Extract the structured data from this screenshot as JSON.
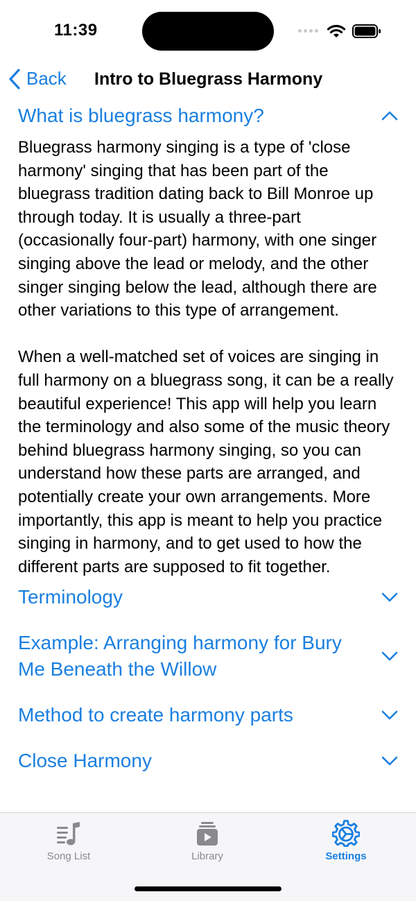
{
  "status_bar": {
    "time": "11:39"
  },
  "nav": {
    "back_label": "Back",
    "title": "Intro to Bluegrass Harmony"
  },
  "sections": [
    {
      "title": "What is bluegrass harmony?",
      "expanded": true,
      "paragraphs": [
        "Bluegrass harmony singing is a type of 'close harmony' singing that has been part of the bluegrass tradition dating back to Bill Monroe up through today. It is usually a three-part (occasionally four-part) harmony, with one singer singing above the lead or melody, and the other singer singing below the lead, although there are other variations to this type of arrangement.",
        "When a well-matched set of voices are singing in full harmony on a bluegrass song, it can be a really beautiful experience! This app will help you learn the terminology and also some of the music theory behind bluegrass harmony singing, so you can understand how these parts are arranged, and potentially create your own arrangements. More importantly, this app is meant to help you practice singing in harmony, and to get used to how the different parts are supposed to fit together."
      ]
    },
    {
      "title": "Terminology",
      "expanded": false
    },
    {
      "title": "Example: Arranging harmony for Bury Me Beneath the Willow",
      "expanded": false
    },
    {
      "title": "Method to create harmony parts",
      "expanded": false
    },
    {
      "title": "Close Harmony",
      "expanded": false
    }
  ],
  "tabs": [
    {
      "label": "Song List",
      "icon": "music-note-list-icon",
      "active": false
    },
    {
      "label": "Library",
      "icon": "play-stack-icon",
      "active": false
    },
    {
      "label": "Settings",
      "icon": "gear-icon",
      "active": true
    }
  ],
  "colors": {
    "accent": "#1a7fe0",
    "inactive": "#8a8a8e",
    "tab_bar_bg": "#f6f6f8"
  }
}
